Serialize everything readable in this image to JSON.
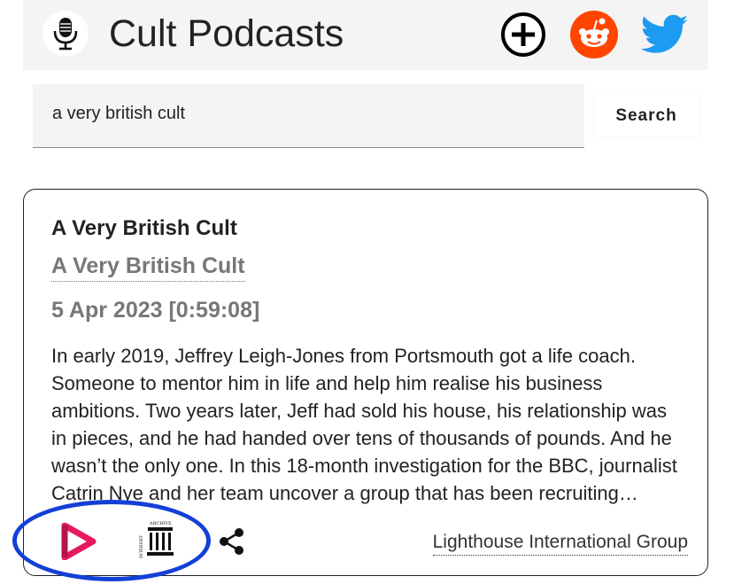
{
  "header": {
    "title": "Cult Podcasts",
    "logo_icon": "microphone-icon",
    "actions": [
      {
        "name": "add",
        "icon": "plus-circle-icon"
      },
      {
        "name": "reddit",
        "icon": "reddit-icon",
        "color": "#ff4500"
      },
      {
        "name": "twitter",
        "icon": "twitter-icon",
        "color": "#1d9bf0"
      }
    ]
  },
  "search": {
    "value": "a very british cult",
    "button_label": "Search"
  },
  "result": {
    "episode_title": "A Very British Cult",
    "podcast_name": "A Very British Cult",
    "date_duration": "5 Apr 2023 [0:59:08]",
    "description": "In early 2019, Jeffrey Leigh-Jones from Portsmouth got a life coach. Someone to mentor him in life and help him realise his business ambitions. Two years later, Jeff had sold his house, his relationship was in pieces, and he had handed over tens of thousands of pounds. And he wasn’t the only one. In this 18-month investigation for the BBC, journalist Catrin Nye and her team uncover a group that has been recruiting people across the UK.",
    "tag": "Lighthouse International Group",
    "icons": [
      "castbox-icon",
      "internet-archive-icon",
      "share-icon"
    ]
  },
  "colors": {
    "header_bg": "#f4f4f4",
    "castbox_pink": "#e6195f",
    "highlight_blue": "#1440d6"
  }
}
